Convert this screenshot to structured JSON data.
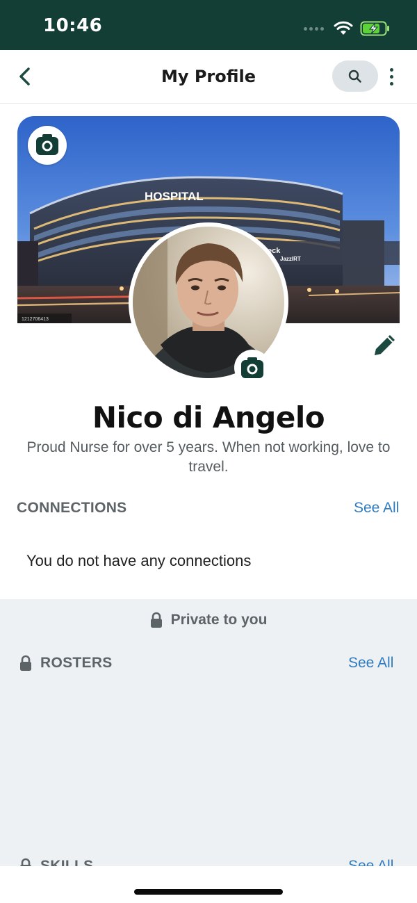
{
  "status_bar": {
    "time": "10:46"
  },
  "nav": {
    "title": "My Profile"
  },
  "cover": {
    "building_sign": "HOSPITAL",
    "overlay_text": "eck",
    "overlay_sub": "JazzIRT",
    "stamp": "1212706413"
  },
  "profile": {
    "name": "Nico di Angelo",
    "bio": "Proud Nurse for over 5 years. When not working, love to travel."
  },
  "connections": {
    "heading": "CONNECTIONS",
    "see_all": "See All",
    "empty_message": "You do not have any connections"
  },
  "private": {
    "label": "Private to you",
    "rosters": {
      "heading": "ROSTERS",
      "see_all": "See All"
    },
    "skills": {
      "heading": "SKILLS",
      "see_all": "See All"
    }
  },
  "colors": {
    "header": "#123e36",
    "accent_icon": "#1d4a40",
    "link": "#2f7bbf",
    "private_bg": "#edf1f3"
  }
}
